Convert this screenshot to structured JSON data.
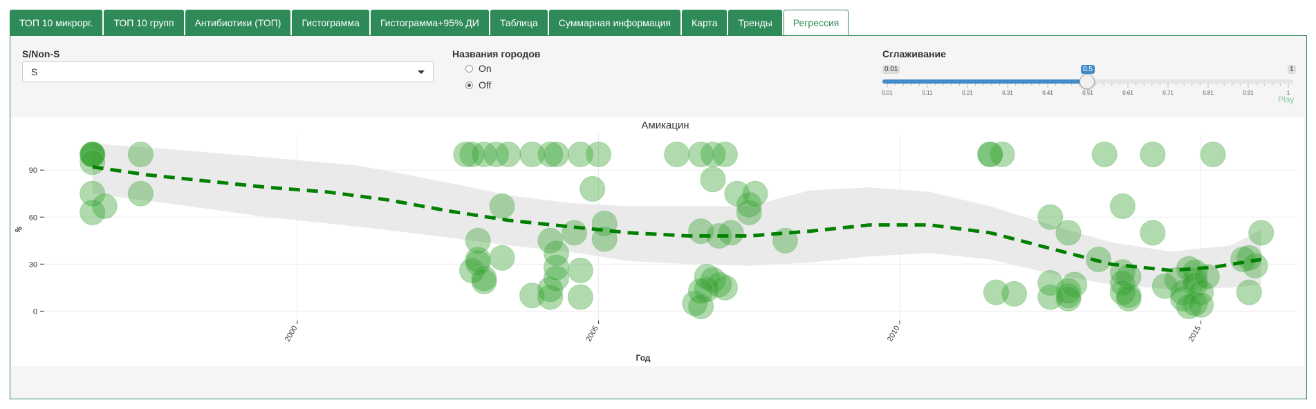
{
  "tabs": [
    {
      "label": "ТОП 10 микрорг."
    },
    {
      "label": "ТОП 10 групп"
    },
    {
      "label": "Антибиотики (ТОП)"
    },
    {
      "label": "Гистограмма"
    },
    {
      "label": "Гистограмма+95% ДИ"
    },
    {
      "label": "Таблица"
    },
    {
      "label": "Суммарная информация"
    },
    {
      "label": "Карта"
    },
    {
      "label": "Тренды"
    },
    {
      "label": "Регрессия"
    }
  ],
  "active_tab": "Регрессия",
  "controls": {
    "sns_label": "S/Non-S",
    "sns_value": "S",
    "cities_label": "Названия городов",
    "radio_on": "On",
    "radio_off": "Off",
    "radio_selected": "Off",
    "smooth_label": "Сглаживание",
    "smooth_min": "0.01",
    "smooth_max": "1",
    "smooth_value": "0.5",
    "smooth_ticks": [
      "0.01",
      "0.11",
      "0.21",
      "0.31",
      "0.41",
      "0.51",
      "0.61",
      "0.71",
      "0.81",
      "0.91",
      "1"
    ],
    "play_label": "Play"
  },
  "colors": {
    "accent": "#2e8b57",
    "point": "#33a02c",
    "trend": "#008000",
    "band": "#e6e6e6"
  },
  "chart_data": {
    "type": "scatter",
    "title": "Амикацин",
    "xlabel": "Год",
    "ylabel": "%",
    "xlim": [
      1995.8,
      2016.6
    ],
    "ylim": [
      -6,
      113
    ],
    "x_ticks": [
      2000,
      2005,
      2010,
      2015
    ],
    "y_ticks": [
      0,
      30,
      60,
      90
    ],
    "grid": true,
    "points": [
      {
        "x": 1996.6,
        "y": 100
      },
      {
        "x": 1996.6,
        "y": 100
      },
      {
        "x": 1996.6,
        "y": 100
      },
      {
        "x": 1996.6,
        "y": 100
      },
      {
        "x": 1996.6,
        "y": 95
      },
      {
        "x": 1996.6,
        "y": 75
      },
      {
        "x": 1996.6,
        "y": 63
      },
      {
        "x": 1996.8,
        "y": 67
      },
      {
        "x": 1997.4,
        "y": 100
      },
      {
        "x": 1997.4,
        "y": 75
      },
      {
        "x": 2002.8,
        "y": 100
      },
      {
        "x": 2002.9,
        "y": 100
      },
      {
        "x": 2003.1,
        "y": 100
      },
      {
        "x": 2003.3,
        "y": 100
      },
      {
        "x": 2003.5,
        "y": 100
      },
      {
        "x": 2003.9,
        "y": 100
      },
      {
        "x": 2004.2,
        "y": 100
      },
      {
        "x": 2004.3,
        "y": 100
      },
      {
        "x": 2004.7,
        "y": 100
      },
      {
        "x": 2005.0,
        "y": 100
      },
      {
        "x": 2003.4,
        "y": 67
      },
      {
        "x": 2004.9,
        "y": 78
      },
      {
        "x": 2005.1,
        "y": 56
      },
      {
        "x": 2005.1,
        "y": 46
      },
      {
        "x": 2004.6,
        "y": 50
      },
      {
        "x": 2004.2,
        "y": 45
      },
      {
        "x": 2004.3,
        "y": 37
      },
      {
        "x": 2004.3,
        "y": 28
      },
      {
        "x": 2004.3,
        "y": 21
      },
      {
        "x": 2004.2,
        "y": 14
      },
      {
        "x": 2004.2,
        "y": 9
      },
      {
        "x": 2003.9,
        "y": 10
      },
      {
        "x": 2004.7,
        "y": 26
      },
      {
        "x": 2004.7,
        "y": 9
      },
      {
        "x": 2003.0,
        "y": 45
      },
      {
        "x": 2003.0,
        "y": 33
      },
      {
        "x": 2003.0,
        "y": 31
      },
      {
        "x": 2002.9,
        "y": 26
      },
      {
        "x": 2003.1,
        "y": 21
      },
      {
        "x": 2003.1,
        "y": 19
      },
      {
        "x": 2003.4,
        "y": 34
      },
      {
        "x": 2006.3,
        "y": 100
      },
      {
        "x": 2006.7,
        "y": 100
      },
      {
        "x": 2006.9,
        "y": 100
      },
      {
        "x": 2007.1,
        "y": 100
      },
      {
        "x": 2006.9,
        "y": 84
      },
      {
        "x": 2007.3,
        "y": 75
      },
      {
        "x": 2007.6,
        "y": 75
      },
      {
        "x": 2007.5,
        "y": 68
      },
      {
        "x": 2007.5,
        "y": 63
      },
      {
        "x": 2006.7,
        "y": 51
      },
      {
        "x": 2007.0,
        "y": 48
      },
      {
        "x": 2007.2,
        "y": 50
      },
      {
        "x": 2008.1,
        "y": 45
      },
      {
        "x": 2006.8,
        "y": 22
      },
      {
        "x": 2006.9,
        "y": 20
      },
      {
        "x": 2007.0,
        "y": 17
      },
      {
        "x": 2007.1,
        "y": 15
      },
      {
        "x": 2006.8,
        "y": 14
      },
      {
        "x": 2006.7,
        "y": 13
      },
      {
        "x": 2006.6,
        "y": 5
      },
      {
        "x": 2006.7,
        "y": 3
      },
      {
        "x": 2011.5,
        "y": 100
      },
      {
        "x": 2011.5,
        "y": 100
      },
      {
        "x": 2011.7,
        "y": 100
      },
      {
        "x": 2011.6,
        "y": 12
      },
      {
        "x": 2011.9,
        "y": 11
      },
      {
        "x": 2012.5,
        "y": 60
      },
      {
        "x": 2012.8,
        "y": 50
      },
      {
        "x": 2012.5,
        "y": 18
      },
      {
        "x": 2012.9,
        "y": 17
      },
      {
        "x": 2012.5,
        "y": 9
      },
      {
        "x": 2012.8,
        "y": 13
      },
      {
        "x": 2012.8,
        "y": 10
      },
      {
        "x": 2012.8,
        "y": 8
      },
      {
        "x": 2013.3,
        "y": 33
      },
      {
        "x": 2013.4,
        "y": 100
      },
      {
        "x": 2014.2,
        "y": 100
      },
      {
        "x": 2015.2,
        "y": 100
      },
      {
        "x": 2013.7,
        "y": 67
      },
      {
        "x": 2014.2,
        "y": 50
      },
      {
        "x": 2013.7,
        "y": 25
      },
      {
        "x": 2013.8,
        "y": 22
      },
      {
        "x": 2013.7,
        "y": 18
      },
      {
        "x": 2013.7,
        "y": 12
      },
      {
        "x": 2013.8,
        "y": 8
      },
      {
        "x": 2013.8,
        "y": 10
      },
      {
        "x": 2014.4,
        "y": 16
      },
      {
        "x": 2014.6,
        "y": 20
      },
      {
        "x": 2014.7,
        "y": 12
      },
      {
        "x": 2014.7,
        "y": 8
      },
      {
        "x": 2014.8,
        "y": 27
      },
      {
        "x": 2014.9,
        "y": 25
      },
      {
        "x": 2014.9,
        "y": 20
      },
      {
        "x": 2014.9,
        "y": 17
      },
      {
        "x": 2015.0,
        "y": 12
      },
      {
        "x": 2014.9,
        "y": 5
      },
      {
        "x": 2014.8,
        "y": 3
      },
      {
        "x": 2015.0,
        "y": 4
      },
      {
        "x": 2015.1,
        "y": 22
      },
      {
        "x": 2015.7,
        "y": 33
      },
      {
        "x": 2015.8,
        "y": 34
      },
      {
        "x": 2015.9,
        "y": 29
      },
      {
        "x": 2016.0,
        "y": 50
      },
      {
        "x": 2015.8,
        "y": 12
      }
    ],
    "trend": [
      {
        "x": 1996.6,
        "y": 92
      },
      {
        "x": 1997.5,
        "y": 87
      },
      {
        "x": 1998.5,
        "y": 83
      },
      {
        "x": 1999.5,
        "y": 79
      },
      {
        "x": 2000.5,
        "y": 76
      },
      {
        "x": 2001.5,
        "y": 71
      },
      {
        "x": 2002.5,
        "y": 64
      },
      {
        "x": 2003.5,
        "y": 58
      },
      {
        "x": 2004.5,
        "y": 54
      },
      {
        "x": 2005.5,
        "y": 50
      },
      {
        "x": 2006.5,
        "y": 48
      },
      {
        "x": 2007.5,
        "y": 48
      },
      {
        "x": 2008.5,
        "y": 51
      },
      {
        "x": 2009.5,
        "y": 55
      },
      {
        "x": 2010.5,
        "y": 55
      },
      {
        "x": 2011.5,
        "y": 50
      },
      {
        "x": 2012.5,
        "y": 40
      },
      {
        "x": 2013.5,
        "y": 30
      },
      {
        "x": 2014.5,
        "y": 26
      },
      {
        "x": 2015.2,
        "y": 28
      },
      {
        "x": 2016.0,
        "y": 33
      }
    ],
    "ci_upper": [
      {
        "x": 1996.6,
        "y": 107
      },
      {
        "x": 1998.0,
        "y": 103
      },
      {
        "x": 1999.5,
        "y": 98
      },
      {
        "x": 2001.0,
        "y": 93
      },
      {
        "x": 2002.5,
        "y": 82
      },
      {
        "x": 2003.5,
        "y": 74
      },
      {
        "x": 2004.5,
        "y": 69
      },
      {
        "x": 2005.5,
        "y": 67
      },
      {
        "x": 2006.5,
        "y": 67
      },
      {
        "x": 2007.5,
        "y": 67
      },
      {
        "x": 2008.5,
        "y": 77
      },
      {
        "x": 2009.5,
        "y": 79
      },
      {
        "x": 2010.5,
        "y": 76
      },
      {
        "x": 2011.5,
        "y": 67
      },
      {
        "x": 2012.5,
        "y": 55
      },
      {
        "x": 2013.5,
        "y": 44
      },
      {
        "x": 2014.5,
        "y": 38
      },
      {
        "x": 2015.5,
        "y": 42
      },
      {
        "x": 2016.0,
        "y": 52
      }
    ],
    "ci_lower": [
      {
        "x": 1996.6,
        "y": 75
      },
      {
        "x": 1998.0,
        "y": 68
      },
      {
        "x": 1999.5,
        "y": 60
      },
      {
        "x": 2001.0,
        "y": 54
      },
      {
        "x": 2002.5,
        "y": 47
      },
      {
        "x": 2003.5,
        "y": 42
      },
      {
        "x": 2004.5,
        "y": 38
      },
      {
        "x": 2005.5,
        "y": 32
      },
      {
        "x": 2006.5,
        "y": 30
      },
      {
        "x": 2007.5,
        "y": 29
      },
      {
        "x": 2008.5,
        "y": 31
      },
      {
        "x": 2009.5,
        "y": 35
      },
      {
        "x": 2010.5,
        "y": 37
      },
      {
        "x": 2011.5,
        "y": 33
      },
      {
        "x": 2012.5,
        "y": 24
      },
      {
        "x": 2013.5,
        "y": 17
      },
      {
        "x": 2014.5,
        "y": 14
      },
      {
        "x": 2015.5,
        "y": 15
      },
      {
        "x": 2016.0,
        "y": 17
      }
    ]
  }
}
